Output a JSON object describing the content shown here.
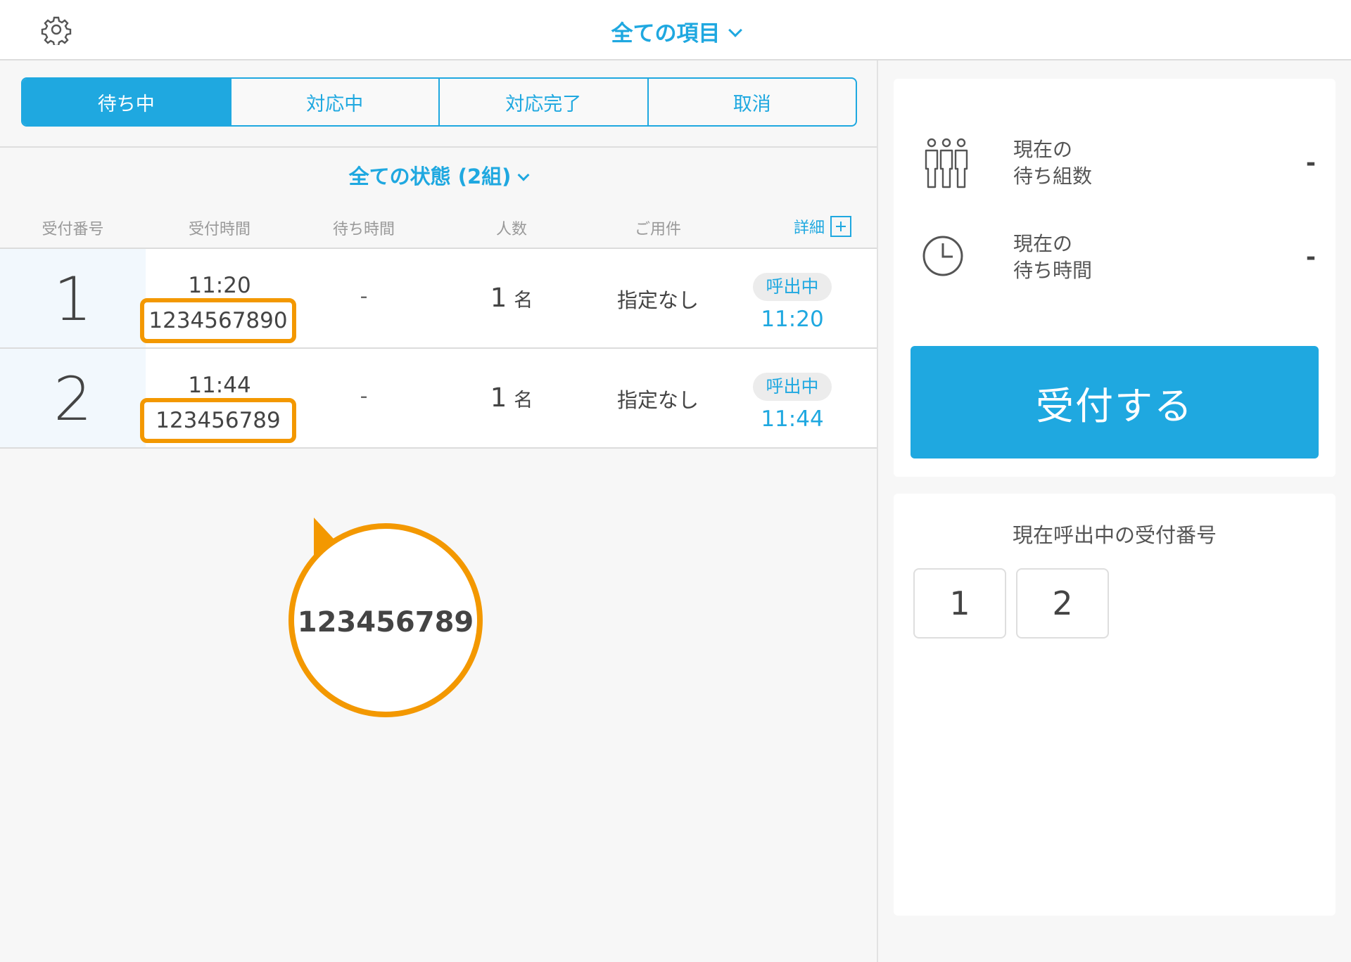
{
  "header": {
    "title": "全ての項目"
  },
  "tabs": [
    {
      "label": "待ち中",
      "active": true
    },
    {
      "label": "対応中",
      "active": false
    },
    {
      "label": "対応完了",
      "active": false
    },
    {
      "label": "取消",
      "active": false
    }
  ],
  "filter": {
    "label": "全ての状態 (2組)"
  },
  "table": {
    "columns": [
      "受付番号",
      "受付時間",
      "待ち時間",
      "人数",
      "ご用件"
    ],
    "detail_label": "詳細",
    "rows": [
      {
        "number": "1",
        "time": "11:20",
        "phone": "1234567890",
        "wait": "-",
        "people": "1",
        "people_unit": "名",
        "purpose": "指定なし",
        "status": "呼出中",
        "call_time": "11:20"
      },
      {
        "number": "2",
        "time": "11:44",
        "phone": "123456789",
        "wait": "-",
        "people": "1",
        "people_unit": "名",
        "purpose": "指定なし",
        "status": "呼出中",
        "call_time": "11:44"
      }
    ]
  },
  "callout": {
    "text": "123456789"
  },
  "stats": {
    "groups": {
      "line1": "現在の",
      "line2": "待ち組数",
      "value": "-",
      "icon": "people-group-icon"
    },
    "wait": {
      "line1": "現在の",
      "line2": "待ち時間",
      "value": "-",
      "icon": "clock-icon"
    }
  },
  "accept_button": "受付する",
  "called": {
    "title": "現在呼出中の受付番号",
    "numbers": [
      "1",
      "2"
    ]
  },
  "colors": {
    "accent": "#1fa8e0",
    "highlight": "#f39800"
  }
}
